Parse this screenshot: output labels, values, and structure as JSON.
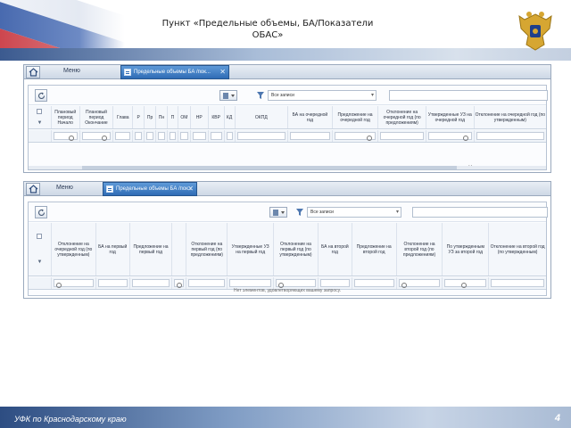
{
  "slide": {
    "title": "Пункт «Предельные объемы, БА/Показатели ОБАС»",
    "footer": "УФК по Краснодарскому краю",
    "page_number": "4"
  },
  "icons": [
    "home-icon",
    "refresh-icon",
    "group-icon",
    "filter-icon",
    "funnel-icon",
    "clock-icon",
    "close-icon",
    "emblem-icon"
  ],
  "window1": {
    "menu_label": "Меню",
    "tab_label": "Предельные объемы БА /пок...",
    "filter_value": "Все записи",
    "columns": [
      "",
      "Плановый период Начало",
      "Плановый период Окончание",
      "Глава",
      "Р",
      "Пр",
      "Пн",
      "П",
      "ОМ",
      "НР",
      "КВР",
      "КД",
      "ОКПД",
      "БА на очередной год",
      "Предложение на очередной год",
      "Отклонение на очередной год (по предложениям)",
      "Утвержденные УЗ на очередной год",
      "Отклонение на очередной год (по утвержденным)"
    ],
    "status": "Нет элементов, удовлетв..."
  },
  "window2": {
    "menu_label": "Меню",
    "tab_label": "Предельные объемы БА /пок...",
    "filter_value": "Все записи",
    "columns": [
      "",
      "Отклонение на очередной год (по утвержденным)",
      "БА на первый год",
      "Предложение на первый год",
      "",
      "Отклонение на первый год (по предложениям)",
      "Утвержденные УЗ на первый год",
      "Отклонение на первый год (по утвержденным)",
      "БА на второй год",
      "Предложение на второй год",
      "Отклонение на второй год (по предложениям)",
      "По утвержденным УЗ за второй год",
      "Отклонение на второй год (по утвержденным)"
    ],
    "status": "Нет элементов, удовлетворяющих вашему запросу."
  }
}
